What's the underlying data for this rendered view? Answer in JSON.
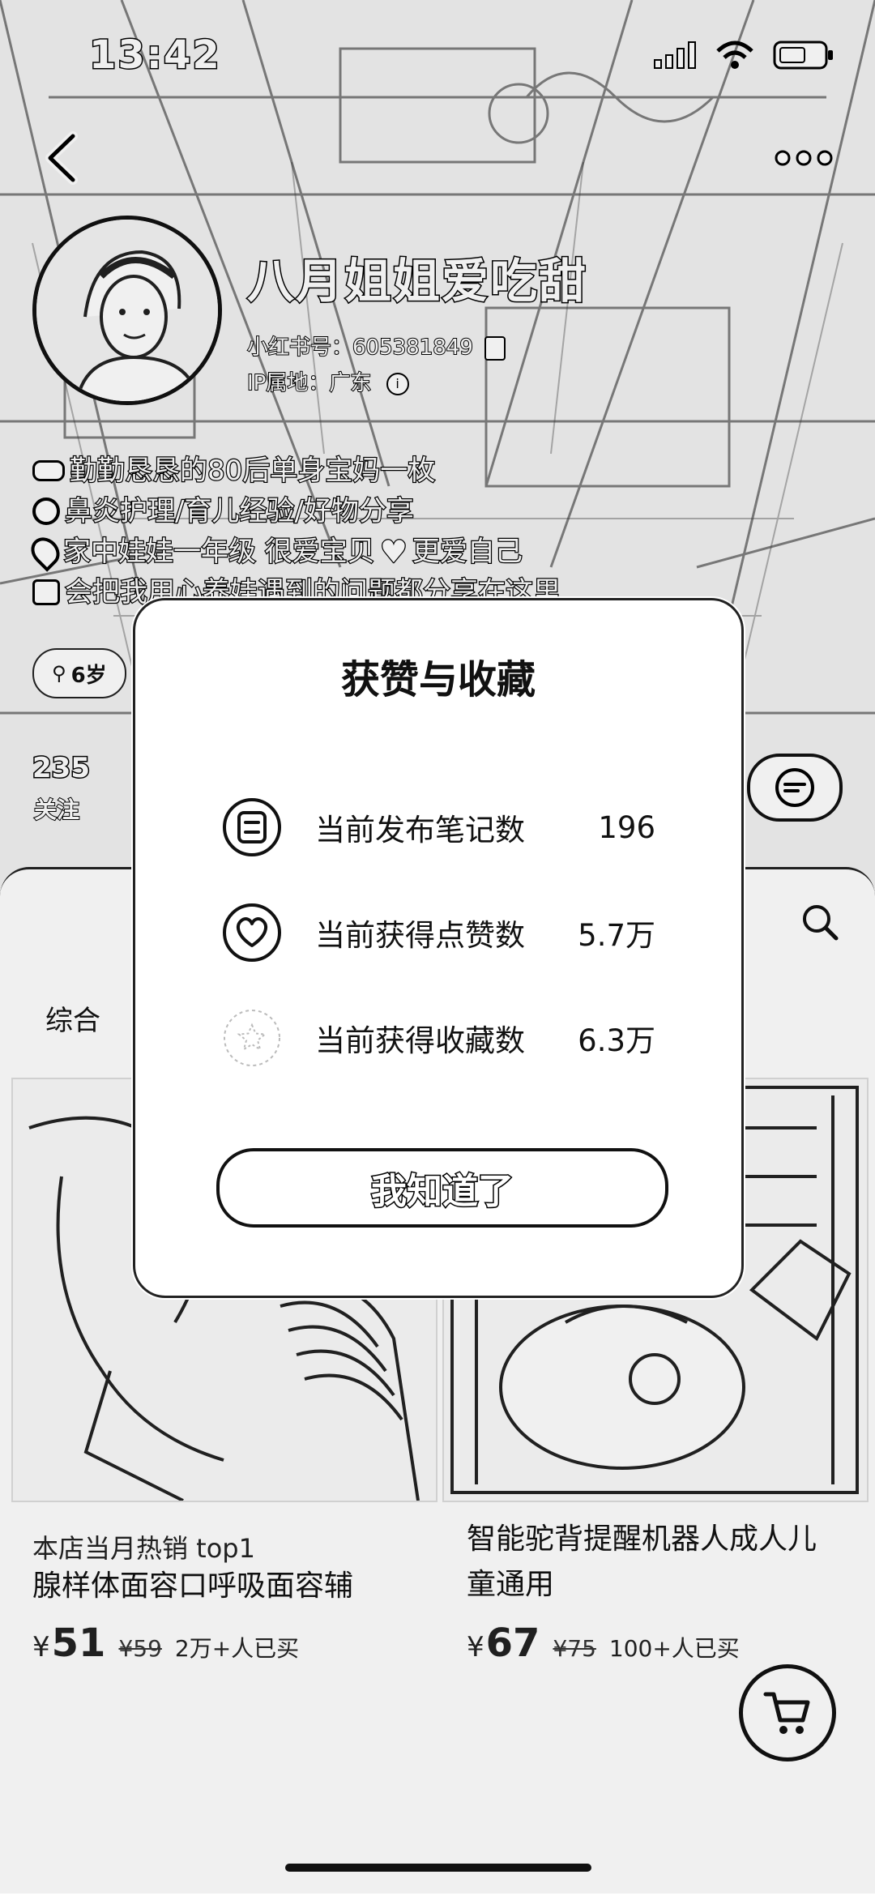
{
  "status_bar": {
    "time": "13:42"
  },
  "profile": {
    "nickname": "八月姐姐爱吃甜",
    "id_label": "小红书号：",
    "id_value": "605381849",
    "ip_label": "IP属地：",
    "ip_value": "广东",
    "bio": [
      "勤勤恳恳的80后单身宝妈一枚",
      "鼻炎护理/育儿经验/好物分享",
      "家中娃娃一年级 很爱宝贝",
      "更爱自己",
      "会把我用心养娃遇到的问题都分享在这里"
    ],
    "age_tag": "6岁",
    "following_count": "235",
    "following_label": "关注"
  },
  "feed": {
    "tab_all": "综合",
    "products": [
      {
        "subtitle": "本店当月热销 top1",
        "title": "腺样体面容口呼吸面容辅",
        "currency": "¥",
        "price": "51",
        "old_price": "¥59",
        "sold": "2万+人已买"
      },
      {
        "title": "智能驼背提醒机器人成人儿童通用",
        "currency": "¥",
        "price": "67",
        "old_price": "¥75",
        "sold": "100+人已买"
      }
    ]
  },
  "modal": {
    "title": "获赞与收藏",
    "stats": [
      {
        "icon": "note-icon",
        "label": "当前发布笔记数",
        "value": "196"
      },
      {
        "icon": "heart-icon",
        "label": "当前获得点赞数",
        "value": "5.7万"
      },
      {
        "icon": "star-icon",
        "label": "当前获得收藏数",
        "value": "6.3万"
      }
    ],
    "confirm_label": "我知道了"
  }
}
